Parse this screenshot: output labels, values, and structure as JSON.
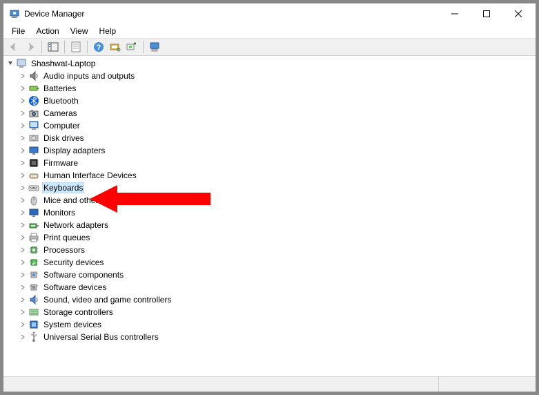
{
  "window": {
    "title": "Device Manager"
  },
  "menu": {
    "file": "File",
    "action": "Action",
    "view": "View",
    "help": "Help"
  },
  "tree": {
    "root": "Shashwat-Laptop",
    "nodes": [
      {
        "label": "Audio inputs and outputs",
        "icon": "audio"
      },
      {
        "label": "Batteries",
        "icon": "battery"
      },
      {
        "label": "Bluetooth",
        "icon": "bluetooth"
      },
      {
        "label": "Cameras",
        "icon": "camera"
      },
      {
        "label": "Computer",
        "icon": "computer"
      },
      {
        "label": "Disk drives",
        "icon": "disk"
      },
      {
        "label": "Display adapters",
        "icon": "display"
      },
      {
        "label": "Firmware",
        "icon": "firmware"
      },
      {
        "label": "Human Interface Devices",
        "icon": "hid"
      },
      {
        "label": "Keyboards",
        "icon": "keyboard",
        "selected": true
      },
      {
        "label": "Mice and other pointing devices",
        "icon": "mouse"
      },
      {
        "label": "Monitors",
        "icon": "monitor"
      },
      {
        "label": "Network adapters",
        "icon": "network"
      },
      {
        "label": "Print queues",
        "icon": "printer"
      },
      {
        "label": "Processors",
        "icon": "cpu"
      },
      {
        "label": "Security devices",
        "icon": "security"
      },
      {
        "label": "Software components",
        "icon": "swcomp"
      },
      {
        "label": "Software devices",
        "icon": "swdev"
      },
      {
        "label": "Sound, video and game controllers",
        "icon": "sound"
      },
      {
        "label": "Storage controllers",
        "icon": "storage"
      },
      {
        "label": "System devices",
        "icon": "system"
      },
      {
        "label": "Universal Serial Bus controllers",
        "icon": "usb"
      }
    ]
  }
}
